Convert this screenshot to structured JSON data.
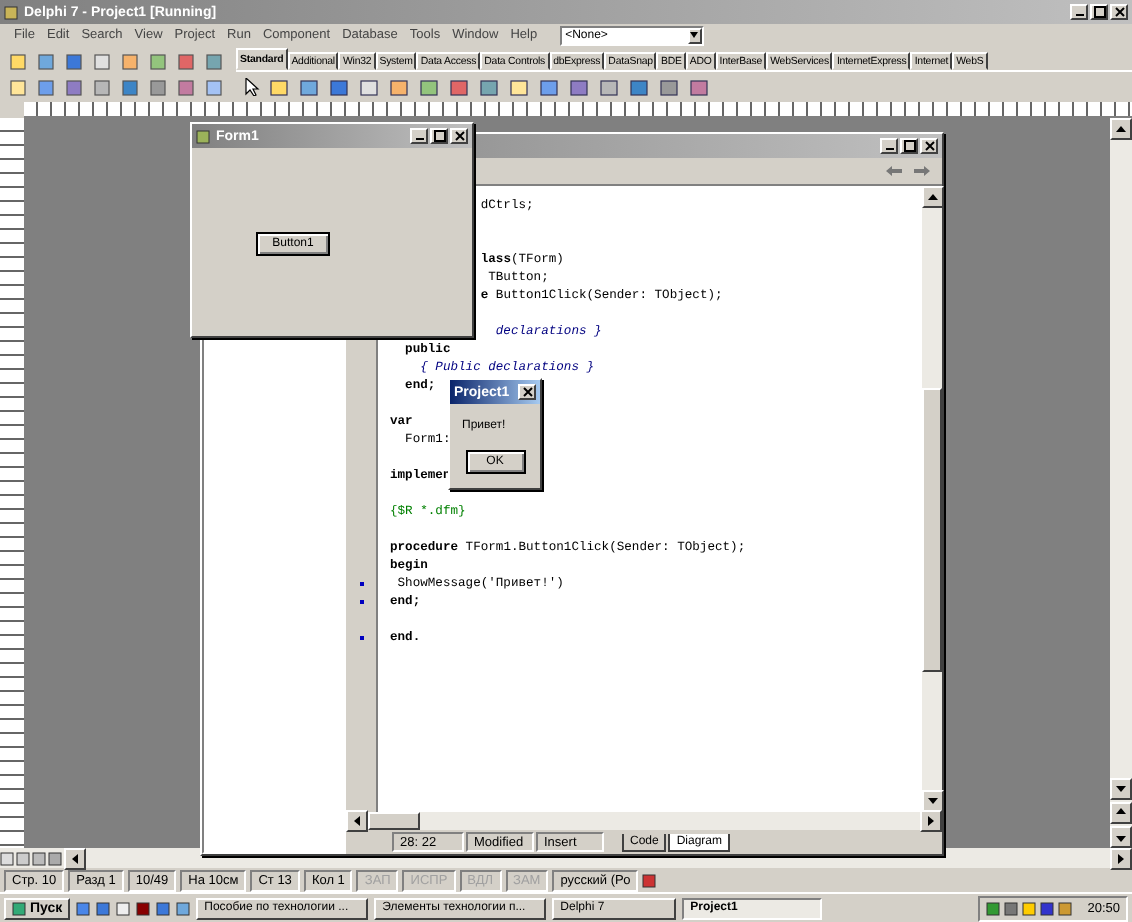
{
  "delphi": {
    "title": "Delphi 7 - Project1 [Running]",
    "menu": [
      "File",
      "Edit",
      "Search",
      "View",
      "Project",
      "Run",
      "Component",
      "Database",
      "Tools",
      "Window",
      "Help"
    ],
    "combo": {
      "value": "<None>"
    },
    "palette_tabs": [
      {
        "label": "Standard",
        "selected": true
      },
      {
        "label": "Additional",
        "selected": false
      },
      {
        "label": "Win32",
        "selected": false
      },
      {
        "label": "System",
        "selected": false
      },
      {
        "label": "Data Access",
        "selected": false
      },
      {
        "label": "Data Controls",
        "selected": false
      },
      {
        "label": "dbExpress",
        "selected": false
      },
      {
        "label": "DataSnap",
        "selected": false
      },
      {
        "label": "BDE",
        "selected": false
      },
      {
        "label": "ADO",
        "selected": false
      },
      {
        "label": "InterBase",
        "selected": false
      },
      {
        "label": "WebServices",
        "selected": false
      },
      {
        "label": "InternetExpress",
        "selected": false
      },
      {
        "label": "Internet",
        "selected": false
      },
      {
        "label": "WebS",
        "selected": false
      }
    ]
  },
  "form1": {
    "title": "Form1",
    "button": "Button1"
  },
  "editor": {
    "lines": [
      {
        "kind": "plain",
        "text": "            dCtrls;",
        "marker": false
      },
      {
        "kind": "blank",
        "marker": false
      },
      {
        "kind": "blank",
        "marker": false
      },
      {
        "kind": "plain",
        "text": "            **lass**(TForm)",
        "marker": false
      },
      {
        "kind": "plain",
        "text": "             TButton;",
        "marker": false
      },
      {
        "kind": "plain",
        "text": "            **e** Button1Click(Sender: TObject);",
        "marker": false
      },
      {
        "kind": "blank",
        "marker": false
      },
      {
        "kind": "comment",
        "text": "              declarations }",
        "marker": false
      },
      {
        "kind": "keyword",
        "text": "  public",
        "marker": false
      },
      {
        "kind": "comment",
        "text": "    { Public declarations }",
        "marker": false
      },
      {
        "kind": "keyword",
        "text": "  end;",
        "marker": false
      },
      {
        "kind": "blank",
        "marker": false
      },
      {
        "kind": "keyword",
        "text": "var",
        "marker": false
      },
      {
        "kind": "plain",
        "text": "  Form1:",
        "marker": false
      },
      {
        "kind": "blank",
        "marker": false
      },
      {
        "kind": "keyword",
        "text": "implemen",
        "marker": false
      },
      {
        "kind": "blank",
        "marker": false
      },
      {
        "kind": "directive",
        "text": "{$R *.dfm}",
        "marker": false
      },
      {
        "kind": "blank",
        "marker": false
      },
      {
        "kind": "plain",
        "text": "**procedure** TForm1.Button1Click(Sender: TObject);",
        "marker": false
      },
      {
        "kind": "keyword",
        "text": "begin",
        "marker": false
      },
      {
        "kind": "plain",
        "text": " ShowMessage('Привет!')",
        "marker": true
      },
      {
        "kind": "keyword",
        "text": "end;",
        "marker": true
      },
      {
        "kind": "blank",
        "marker": false
      },
      {
        "kind": "keyword",
        "text": "end.",
        "marker": true
      }
    ],
    "status": {
      "position": "28: 22",
      "modified": "Modified",
      "mode": "Insert"
    },
    "tabs": [
      {
        "label": "Code",
        "selected": false
      },
      {
        "label": "Diagram",
        "selected": true
      }
    ]
  },
  "dialog": {
    "title": "Project1",
    "message": "Привет!",
    "button": "OK"
  },
  "word_status": [
    {
      "text": "Стр. 10",
      "disabled": false
    },
    {
      "text": "Разд 1",
      "disabled": false
    },
    {
      "text": "10/49",
      "disabled": false
    },
    {
      "text": "На 10см",
      "disabled": false
    },
    {
      "text": "Ст 13",
      "disabled": false
    },
    {
      "text": "Кол 1",
      "disabled": false
    },
    {
      "text": "ЗАП",
      "disabled": true
    },
    {
      "text": "ИСПР",
      "disabled": true
    },
    {
      "text": "ВДЛ",
      "disabled": true
    },
    {
      "text": "ЗАМ",
      "disabled": true
    },
    {
      "text": "русский (Ро",
      "disabled": false
    }
  ],
  "taskbar": {
    "start": "Пуск",
    "tasks": [
      {
        "label": "Пособие по технологии ...",
        "selected": false
      },
      {
        "label": "Элементы технологии п...",
        "selected": false
      },
      {
        "label": "Delphi 7",
        "selected": false
      },
      {
        "label": "Project1",
        "selected": true
      }
    ],
    "clock": "20:50"
  }
}
